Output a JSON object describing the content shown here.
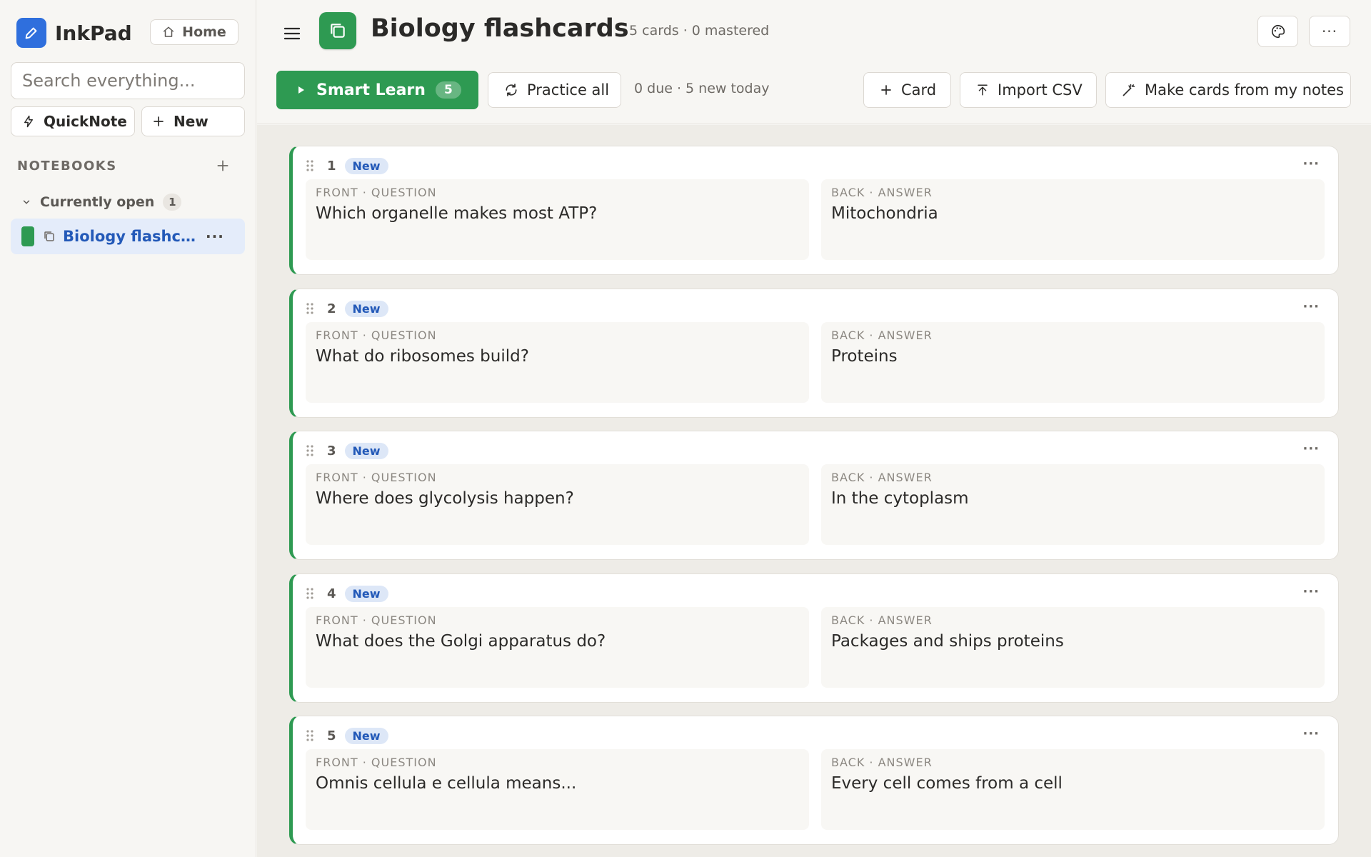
{
  "app": {
    "name": "InkPad",
    "home_label": "Home"
  },
  "search": {
    "placeholder": "Search everything..."
  },
  "sidebar": {
    "quicknote_label": "QuickNote",
    "new_label": "New",
    "notebooks_heading": "NOTEBOOKS",
    "group": {
      "label": "Currently open",
      "count": "1"
    },
    "notebooks": [
      {
        "title": "Biology flashcards",
        "color": "#2e9a52"
      }
    ]
  },
  "header": {
    "title": "Biology flashcards",
    "meta": "5 cards · 0 mastered"
  },
  "toolbar": {
    "smart_learn_label": "Smart Learn",
    "smart_learn_count": "5",
    "practice_label": "Practice all",
    "due_text": "0 due · 5 new today",
    "card_label": "Card",
    "import_label": "Import CSV",
    "make_label": "Make cards from my notes"
  },
  "cards": [
    {
      "number": "1",
      "status": "New",
      "front_label": "FRONT · QUESTION",
      "front": "Which organelle makes most ATP?",
      "back_label": "BACK · ANSWER",
      "back": "Mitochondria"
    },
    {
      "number": "2",
      "status": "New",
      "front_label": "FRONT · QUESTION",
      "front": "What do ribosomes build?",
      "back_label": "BACK · ANSWER",
      "back": "Proteins"
    },
    {
      "number": "3",
      "status": "New",
      "front_label": "FRONT · QUESTION",
      "front": "Where does glycolysis happen?",
      "back_label": "BACK · ANSWER",
      "back": "In the cytoplasm"
    },
    {
      "number": "4",
      "status": "New",
      "front_label": "FRONT · QUESTION",
      "front": "What does the Golgi apparatus do?",
      "back_label": "BACK · ANSWER",
      "back": "Packages and ships proteins"
    },
    {
      "number": "5",
      "status": "New",
      "front_label": "FRONT · QUESTION",
      "front": "Omnis cellula e cellula means...",
      "back_label": "BACK · ANSWER",
      "back": "Every cell comes from a cell"
    }
  ],
  "colors": {
    "accent": "#2e9a52",
    "brand": "#2f6fdd",
    "link": "#2359b8"
  },
  "icons": {
    "logo": "pencil-icon",
    "home": "home-icon",
    "quicknote": "bolt-icon",
    "new": "plus-icon",
    "menu": "hamburger-icon",
    "deck": "cards-icon",
    "palette": "palette-icon",
    "more": "ellipsis-icon",
    "play": "play-icon",
    "practice": "refresh-icon",
    "import": "upload-icon",
    "make": "magic-wand-icon",
    "drag": "drag-handle-icon"
  }
}
